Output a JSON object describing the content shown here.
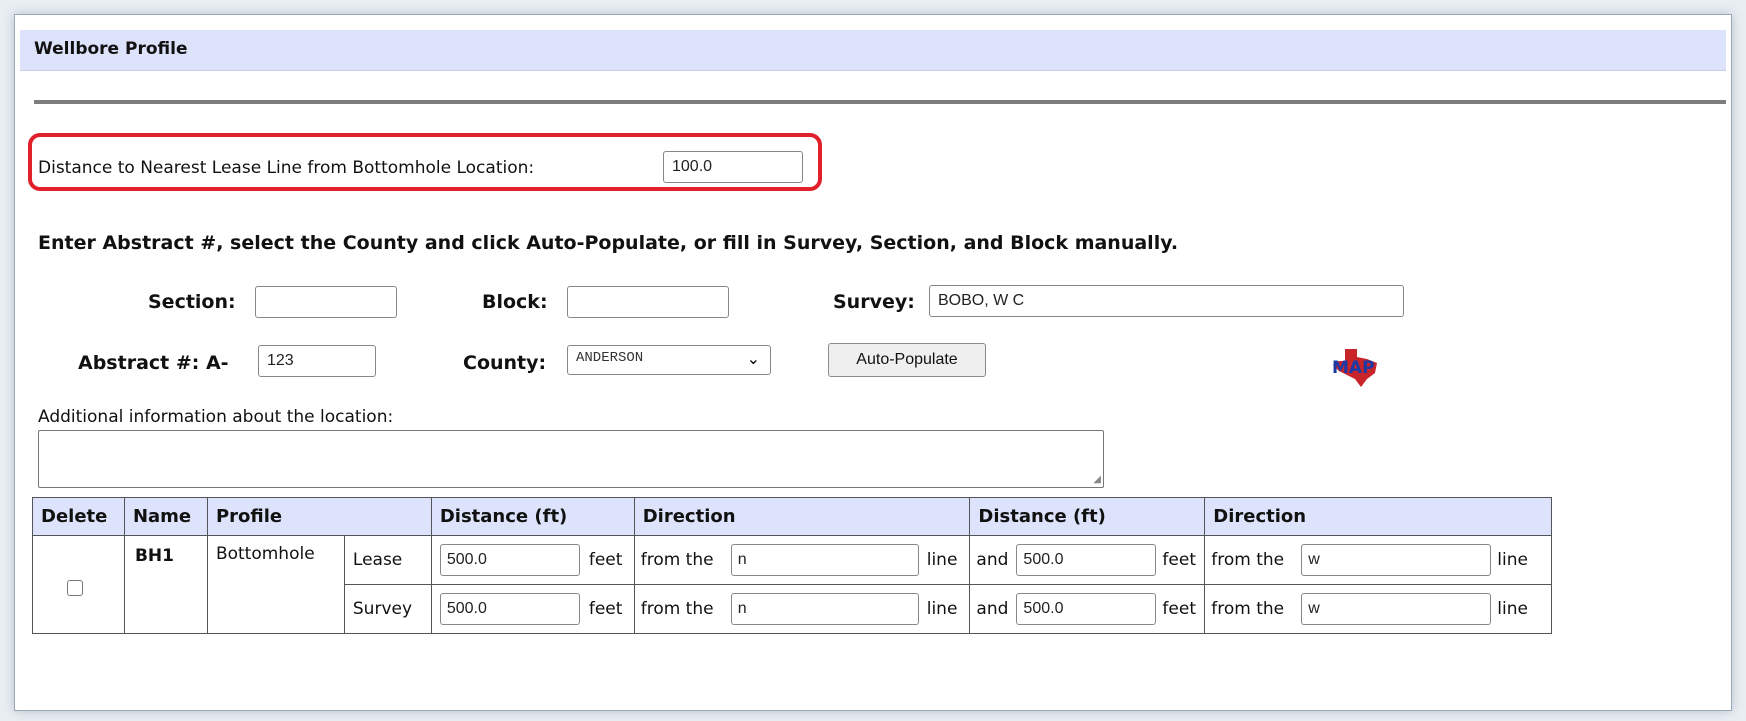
{
  "panel": {
    "title": "Wellbore Profile"
  },
  "lease_line": {
    "label": "Distance to Nearest Lease Line from Bottomhole Location:",
    "value": "100.0"
  },
  "instructions": "Enter Abstract #, select the County and click Auto-Populate, or fill in Survey, Section, and Block manually.",
  "location": {
    "section_label": "Section:",
    "section_value": "",
    "block_label": "Block:",
    "block_value": "",
    "survey_label": "Survey:",
    "survey_value": "BOBO, W C",
    "abstract_label": "Abstract #: A-",
    "abstract_value": "123",
    "county_label": "County:",
    "county_value": "ANDERSON",
    "auto_populate_label": "Auto-Populate",
    "map_icon_text": "MAP",
    "additional_label": "Additional information about the location:",
    "additional_value": ""
  },
  "table": {
    "headers": [
      "Delete",
      "Name",
      "Profile",
      "Distance (ft)",
      "Direction",
      "Distance (ft)",
      "Direction"
    ],
    "row": {
      "name": "BH1",
      "profile": "Bottomhole",
      "feet": "feet",
      "from_the": "from the",
      "line": "line",
      "and": "and",
      "lines": [
        {
          "type": "Lease",
          "dist1": "500.0",
          "dir1": "n",
          "dist2": "500.0",
          "dir2": "w"
        },
        {
          "type": "Survey",
          "dist1": "500.0",
          "dir1": "n",
          "dist2": "500.0",
          "dir2": "w"
        }
      ]
    }
  },
  "colors": {
    "header_bg": "#dde3fb",
    "highlight": "#e0202a"
  }
}
